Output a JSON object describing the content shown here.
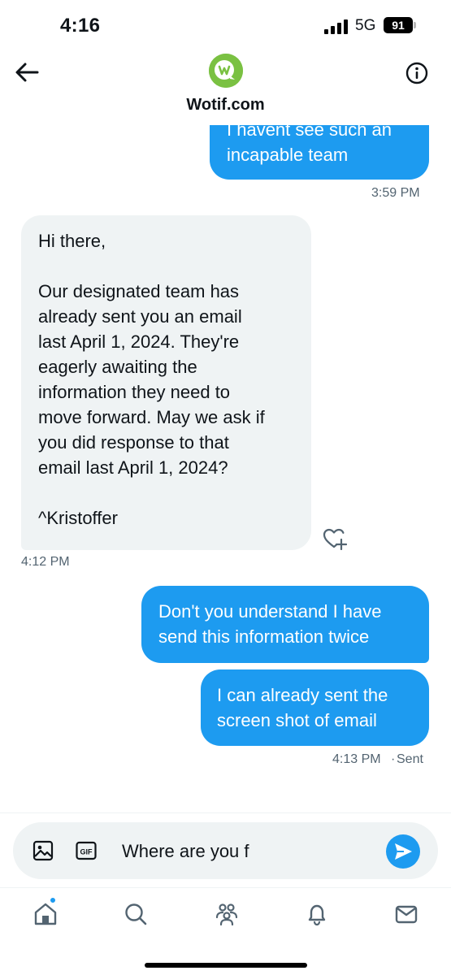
{
  "status_bar": {
    "time": "4:16",
    "network": "5G",
    "battery": "91"
  },
  "header": {
    "title": "Wotif.com",
    "avatar_letter": "w",
    "avatar_color": "#7ac142"
  },
  "messages": [
    {
      "direction": "outgoing",
      "lines": [
        "I havent see such an",
        "incapable team"
      ],
      "timestamp": "3:59 PM"
    },
    {
      "direction": "incoming",
      "lines": [
        "Hi there,",
        "",
        "Our designated team has",
        "already sent you an email",
        "last April 1, 2024. They're",
        "eagerly awaiting the",
        "information they need to",
        "move forward. May we ask if",
        "you did response to that",
        "email last April 1, 2024?",
        "",
        "^Kristoffer"
      ],
      "timestamp": "4:12 PM"
    },
    {
      "direction": "outgoing",
      "lines": [
        "Don't you understand I have",
        "send this information twice"
      ]
    },
    {
      "direction": "outgoing",
      "lines": [
        "I can already sent the",
        "screen shot of email"
      ],
      "timestamp": "4:13 PM",
      "status": "Sent"
    }
  ],
  "compose": {
    "value": "Where are you f",
    "gif_label": "GIF"
  },
  "colors": {
    "accent": "#1d9bf0",
    "incoming_bubble": "#eff3f4",
    "secondary_text": "#536471"
  },
  "icons": {
    "back": "arrow-left-icon",
    "info": "info-icon",
    "react": "heart-plus-icon",
    "media": "image-icon",
    "gif": "gif-icon",
    "send": "send-icon",
    "nav": [
      "home-icon",
      "search-icon",
      "communities-icon",
      "notifications-icon",
      "messages-icon"
    ]
  }
}
